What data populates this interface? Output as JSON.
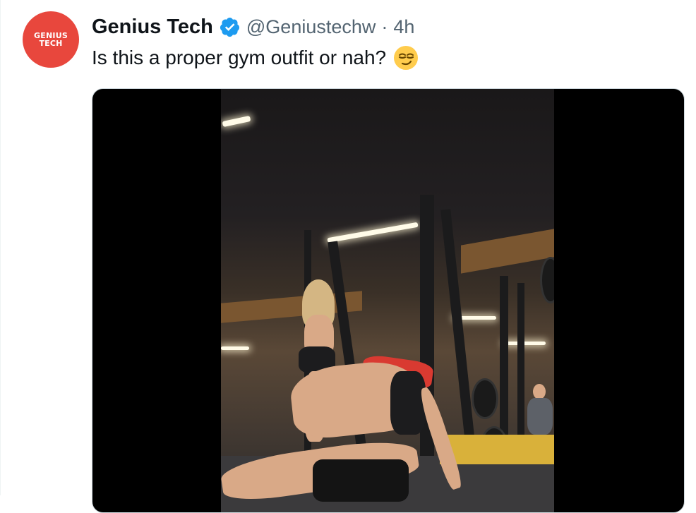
{
  "tweet": {
    "avatar_text_line1": "GENIUS",
    "avatar_text_line2": "TECH",
    "display_name": "Genius Tech",
    "verified": true,
    "handle": "@Geniustechw",
    "separator": "·",
    "time": "4h",
    "text": "Is this a proper gym outfit or nah?",
    "emoji": "smirking-face-icon"
  },
  "colors": {
    "avatar_bg": "#e8473d",
    "verified_blue": "#1d9bf0",
    "secondary_text": "#536471",
    "media_border": "#cfd9de"
  },
  "media": {
    "type": "video",
    "description_icon": "video-thumbnail"
  }
}
